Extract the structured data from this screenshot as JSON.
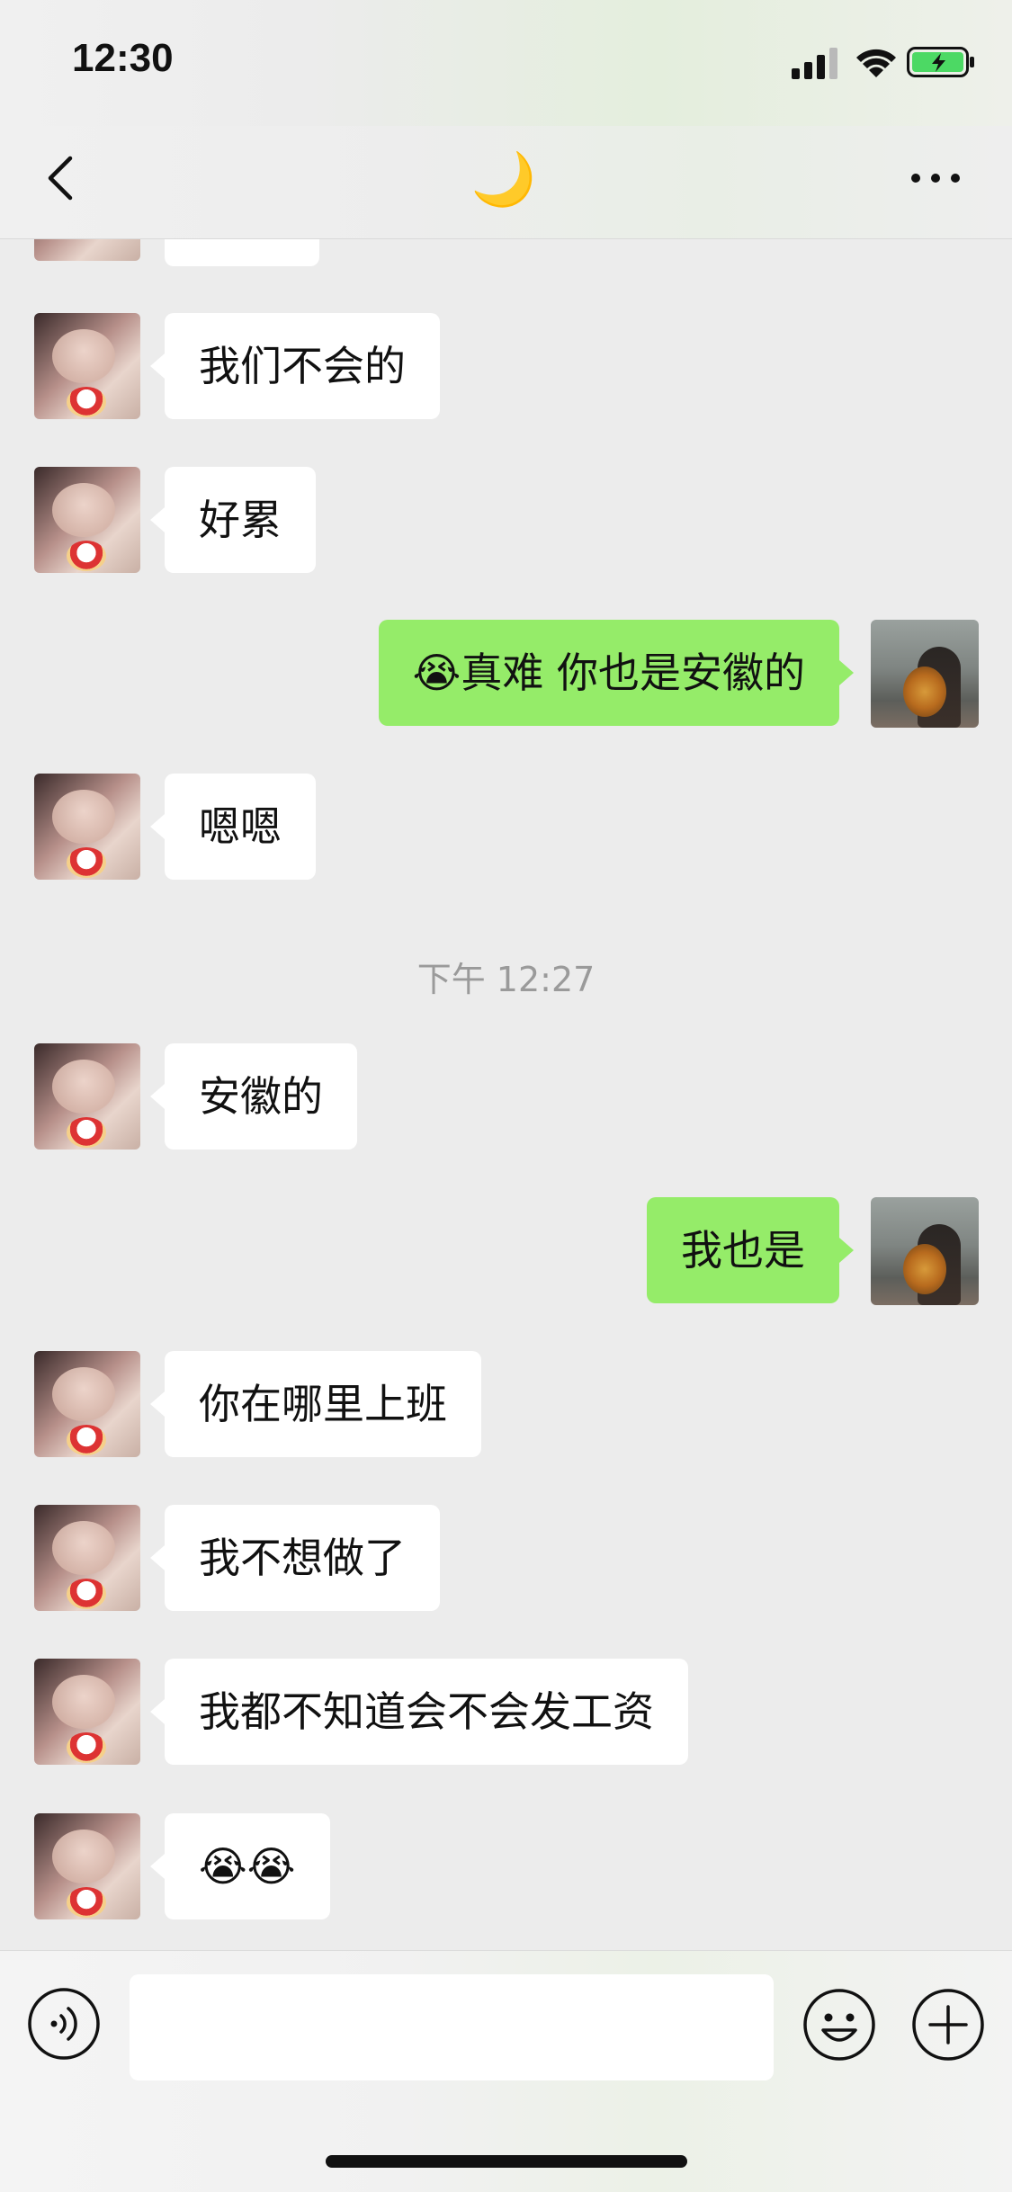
{
  "status_bar": {
    "time": "12:30"
  },
  "nav": {
    "title": "🌙"
  },
  "messages": [
    {
      "side": "in",
      "text": "我们不会的"
    },
    {
      "side": "in",
      "text": "好累"
    },
    {
      "side": "out",
      "text": "😭真难 你也是安徽的"
    },
    {
      "side": "in",
      "text": "嗯嗯"
    },
    {
      "side": "in",
      "text": "安徽的"
    },
    {
      "side": "out",
      "text": "我也是"
    },
    {
      "side": "in",
      "text": "你在哪里上班"
    },
    {
      "side": "in",
      "text": "我不想做了"
    },
    {
      "side": "in",
      "text": "我都不知道会不会发工资"
    },
    {
      "side": "in",
      "text": "😭😭"
    }
  ],
  "timestamp": "下午 12:27",
  "colors": {
    "incoming_bubble": "#ffffff",
    "outgoing_bubble": "#95ec69",
    "background": "#ececec"
  },
  "icons": {
    "back": "chevron-left-icon",
    "more": "more-dots-icon",
    "voice": "voice-icon",
    "emoji": "emoji-icon",
    "plus": "plus-icon"
  }
}
